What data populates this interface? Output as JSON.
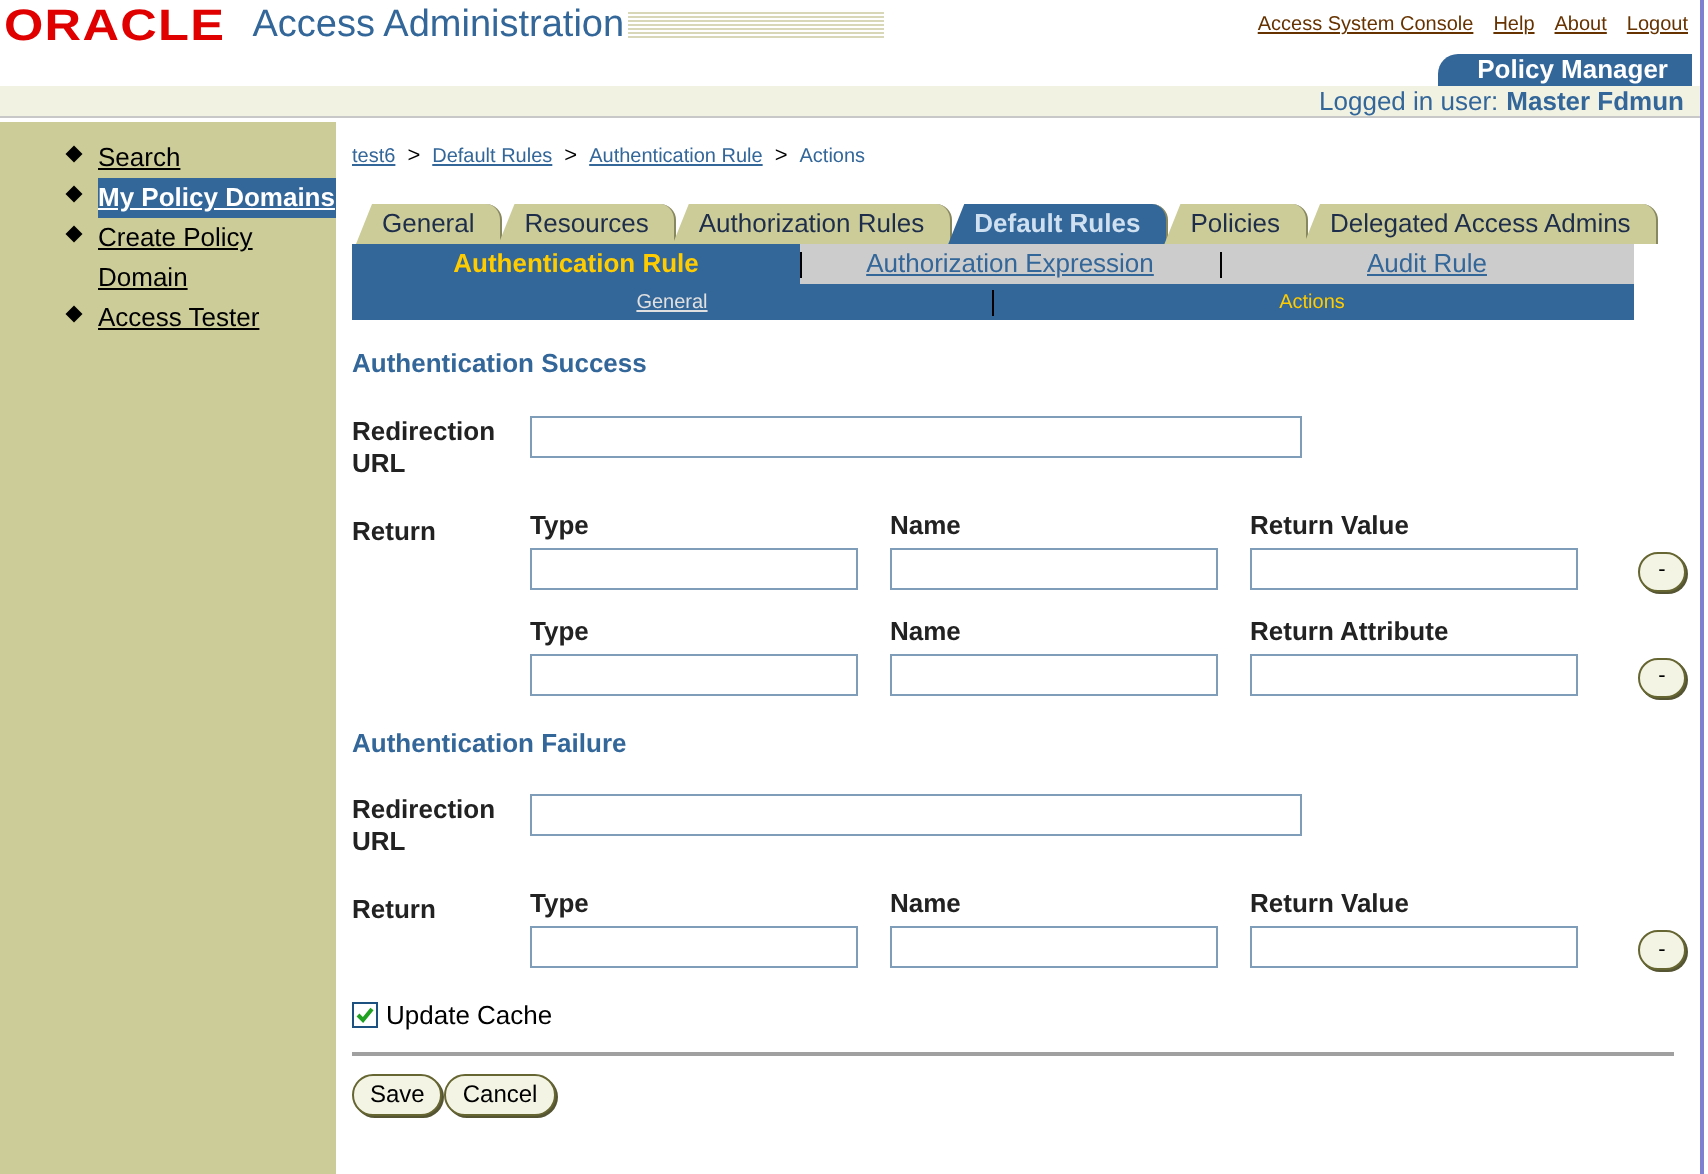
{
  "header": {
    "logo": "ORACLE",
    "title": "Access Administration",
    "links": [
      "Access System Console",
      "Help",
      "About",
      "Logout"
    ],
    "app_tab": "Policy Manager",
    "logged_in_label": "Logged in user:",
    "user": "Master Fdmun"
  },
  "sidebar": {
    "items": [
      {
        "label": "Search",
        "selected": false
      },
      {
        "label": "My Policy Domains",
        "selected": true
      },
      {
        "label": "Create Policy Domain",
        "selected": false
      },
      {
        "label": "Access Tester",
        "selected": false
      }
    ]
  },
  "breadcrumb": [
    {
      "text": "test6",
      "kind": "link"
    },
    {
      "text": ">",
      "kind": "separator"
    },
    {
      "text": "Default Rules",
      "kind": "link"
    },
    {
      "text": ">",
      "kind": "separator"
    },
    {
      "text": "Authentication Rule",
      "kind": "link"
    },
    {
      "text": ">",
      "kind": "separator"
    },
    {
      "text": "Actions",
      "kind": "current"
    }
  ],
  "tabs": [
    {
      "label": "General",
      "selected": false
    },
    {
      "label": "Resources",
      "selected": false
    },
    {
      "label": "Authorization Rules",
      "selected": false
    },
    {
      "label": "Default Rules",
      "selected": true
    },
    {
      "label": "Policies",
      "selected": false
    },
    {
      "label": "Delegated Access Admins",
      "selected": false
    }
  ],
  "subtabs": [
    {
      "label": "Authentication Rule",
      "selected": true
    },
    {
      "label": "Authorization Expression",
      "selected": false
    },
    {
      "label": "Audit Rule",
      "selected": false
    }
  ],
  "subsubtabs": [
    {
      "label": "General",
      "selected": false
    },
    {
      "label": "Actions",
      "selected": true
    }
  ],
  "sections": [
    {
      "title": "Authentication Success",
      "redirect_label": "Redirection URL",
      "return_groups": [
        {
          "row_label": "Return",
          "columns": [
            "Type",
            "Name",
            "Return Value"
          ],
          "remove_button": "-"
        },
        {
          "columns": [
            "Type",
            "Name",
            "Return Attribute"
          ],
          "remove_button": "-"
        }
      ]
    },
    {
      "title": "Authentication Failure",
      "redirect_label": "Redirection URL",
      "return_groups": [
        {
          "row_label": "Return",
          "columns": [
            "Type",
            "Name",
            "Return Value"
          ],
          "remove_button": "-"
        }
      ]
    }
  ],
  "update_cache": {
    "label": "Update Cache",
    "checked": true
  },
  "buttons": [
    "Save",
    "Cancel"
  ]
}
